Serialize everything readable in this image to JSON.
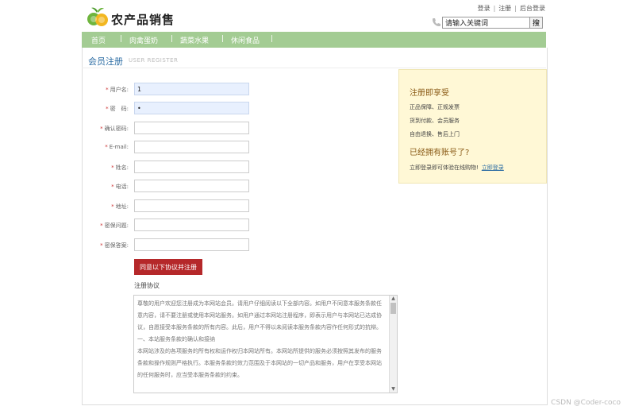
{
  "header": {
    "site_title": "农产品销售",
    "links": [
      "登录",
      "注册",
      "后台登录"
    ],
    "search": {
      "value": "请输入关键词",
      "button_label": "搜"
    }
  },
  "nav": {
    "items": [
      "首页",
      "肉禽蛋奶",
      "蔬菜水果",
      "休闲食品"
    ]
  },
  "page": {
    "title": "会员注册",
    "subtitle": "USER REGISTER"
  },
  "form": {
    "fields": [
      {
        "label": "用户名:",
        "value": "1"
      },
      {
        "label": "密　码:",
        "value": "•"
      },
      {
        "label": "确认密码:",
        "value": ""
      },
      {
        "label": "E-mail:",
        "value": ""
      },
      {
        "label": "姓名:",
        "value": ""
      },
      {
        "label": "电话:",
        "value": ""
      },
      {
        "label": "地址:",
        "value": ""
      },
      {
        "label": "密保问题:",
        "value": ""
      },
      {
        "label": "密保答案:",
        "value": ""
      }
    ],
    "submit_label": "同意以下协议并注册"
  },
  "agreement": {
    "title": "注册协议",
    "paragraphs": [
      "尊敬的用户欢迎您注册成为本网站会员。请用户仔细阅读以下全部内容。如用户不同意本服务条款任意内容，请不要注册或使用本网站服务。如用户通过本网站注册程序，即表示用户与本网站已达成协议，自愿接受本服务条款的所有内容。此后，用户不得以未阅读本服务条款内容作任何形式的抗辩。",
      "一、本站服务条款的确认和接纳",
      "本网站涉及的各项服务的所有权和运作权归本网站所有。本网站所提供的服务必须按照其发布的服务条款和操作规则严格执行。本服务条款的效力范围及于本网站的一切产品和服务，用户在享受本网站的任何服务时，应当受本服务条款的约束。"
    ]
  },
  "sidebar": {
    "heading1": "注册即享受",
    "benefits": [
      "正品保障、正规发票",
      "货到付款、会员服务",
      "自由退换、售后上门"
    ],
    "heading2": "已经拥有账号了?",
    "login_text": "立即登录即可体验在线购物!",
    "login_link": "立即登录"
  },
  "watermark": "CSDN @Coder-coco",
  "colors": {
    "nav": "#a3cc93",
    "button": "#b5282a",
    "sidebar_bg": "#fff8d6",
    "title": "#2b6ca3"
  }
}
